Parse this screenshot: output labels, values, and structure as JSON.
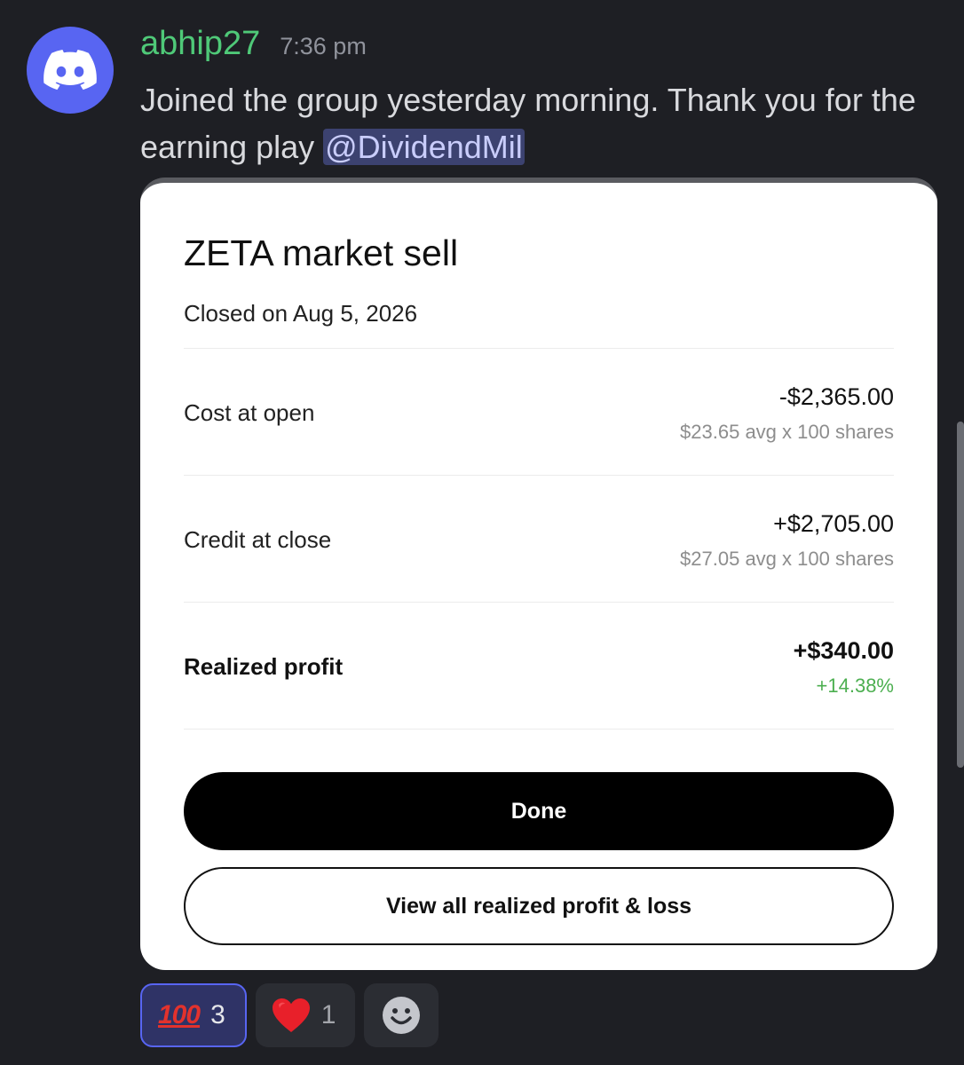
{
  "message": {
    "username": "abhip27",
    "timestamp": "7:36 pm",
    "text_before": "Joined the group yesterday morning. Thank you for the earning play ",
    "mention": "@DividendMil"
  },
  "card": {
    "title": "ZETA market sell",
    "closed_on": "Closed on Aug 5, 2026",
    "rows": [
      {
        "label": "Cost at open",
        "value": "-$2,365.00",
        "detail": "$23.65 avg x 100 shares"
      },
      {
        "label": "Credit at close",
        "value": "+$2,705.00",
        "detail": "$27.05 avg x 100 shares"
      },
      {
        "label": "Realized profit",
        "value": "+$340.00",
        "detail": "+14.38%"
      }
    ],
    "done_label": "Done",
    "view_label": "View all realized profit & loss"
  },
  "reactions": [
    {
      "emoji": "100",
      "count": "3",
      "selected": true
    },
    {
      "emoji": "heart",
      "count": "1",
      "selected": false
    }
  ],
  "colors": {
    "background": "#1e1f24",
    "username": "#4fc978",
    "avatar": "#5865f2",
    "profit_green": "#4caf50"
  },
  "icons": {
    "avatar": "discord-logo-icon",
    "add_reaction": "smiley-face-icon"
  }
}
